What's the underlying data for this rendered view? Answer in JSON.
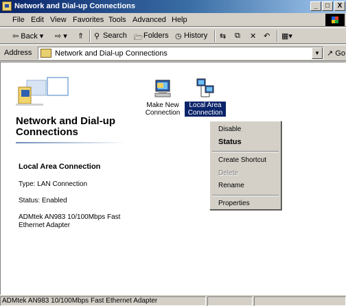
{
  "window": {
    "title": "Network and Dial-up Connections",
    "controls": {
      "minimize": "_",
      "maximize": "□",
      "close": "X"
    }
  },
  "menubar": {
    "items": [
      "File",
      "Edit",
      "View",
      "Favorites",
      "Tools",
      "Advanced",
      "Help"
    ]
  },
  "toolbar": {
    "back": "⇦ Back ▾",
    "forward": "⇨ ▾",
    "up": "⇑",
    "search": "Search",
    "folders": "Folders",
    "history": "History",
    "moveto": "⇆",
    "copyto": "⧉",
    "delete": "✕",
    "undo": "↶",
    "views": "▦▾"
  },
  "address": {
    "label": "Address",
    "value": "Network and Dial-up Connections",
    "go": "Go"
  },
  "panel": {
    "title": "Network and Dial-up Connections",
    "selected_name": "Local Area Connection",
    "type": "Type: LAN Connection",
    "status": "Status: Enabled",
    "adapter": "ADMtek AN983 10/100Mbps Fast Ethernet Adapter"
  },
  "icons": [
    {
      "label": "Make New Connection",
      "selected": false
    },
    {
      "label": "Local Area Connection",
      "selected": true
    }
  ],
  "context_menu": {
    "items": [
      {
        "label": "Disable",
        "bold": false,
        "disabled": false
      },
      {
        "label": "Status",
        "bold": true,
        "disabled": false
      },
      {
        "label": "Create Shortcut",
        "bold": false,
        "disabled": false
      },
      {
        "label": "Delete",
        "bold": false,
        "disabled": true
      },
      {
        "label": "Rename",
        "bold": false,
        "disabled": false
      },
      {
        "label": "Properties",
        "bold": false,
        "disabled": false
      }
    ]
  },
  "statusbar": {
    "text": "ADMtek AN983 10/100Mbps Fast Ethernet Adapter"
  }
}
